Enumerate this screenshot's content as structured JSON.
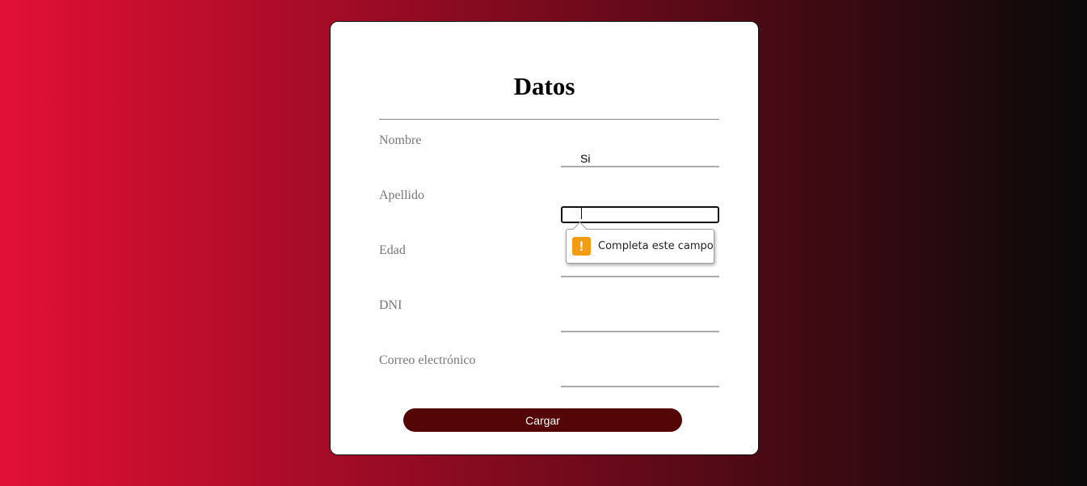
{
  "form": {
    "title": "Datos",
    "fields": [
      {
        "label": "Nombre",
        "value": "Si"
      },
      {
        "label": "Apellido",
        "value": ""
      },
      {
        "label": "Edad",
        "value": ""
      },
      {
        "label": "DNI",
        "value": ""
      },
      {
        "label": "Correo electrónico",
        "value": ""
      }
    ],
    "submit_label": "Cargar"
  },
  "validation_tooltip": {
    "icon": "warning-icon",
    "message": "Completa este campo"
  },
  "colors": {
    "button_bg": "#540505",
    "warning": "#f39c12"
  }
}
